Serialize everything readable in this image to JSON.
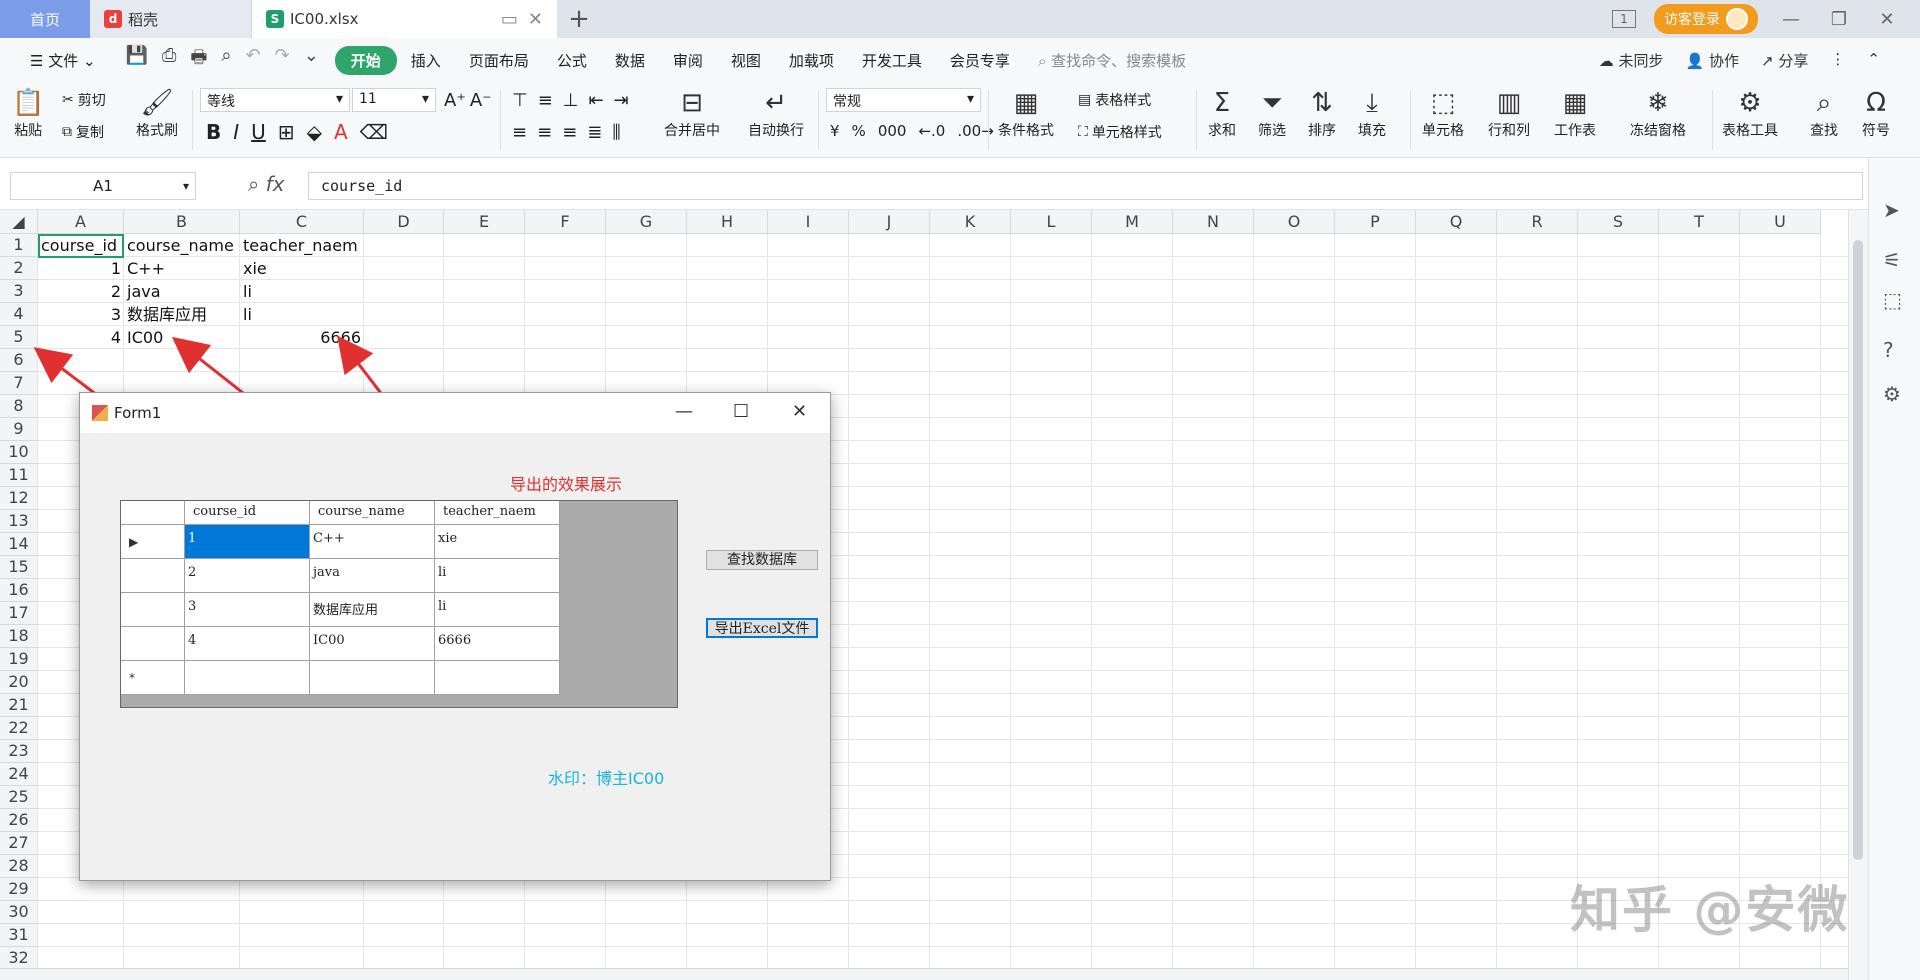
{
  "titlebar": {
    "tabs": [
      {
        "label": "首页"
      },
      {
        "label": "稻壳"
      },
      {
        "label": "IC00.xlsx"
      }
    ],
    "login": "访客登录",
    "page_badge": "1"
  },
  "menubar": {
    "file": "文件",
    "items": [
      "开始",
      "插入",
      "页面布局",
      "公式",
      "数据",
      "审阅",
      "视图",
      "加载项",
      "开发工具",
      "会员专享"
    ],
    "search": "查找命令、搜索模板",
    "sync": "未同步",
    "collab": "协作",
    "share": "分享"
  },
  "ribbon": {
    "paste": "粘贴",
    "cut": "剪切",
    "copy": "复制",
    "format_painter": "格式刷",
    "font": "等线",
    "font_size": "11",
    "merge": "合并居中",
    "wrap": "自动换行",
    "number_format": "常规",
    "cond_format": "条件格式",
    "table_style": "表格样式",
    "cell_style": "单元格样式",
    "sum": "求和",
    "filter": "筛选",
    "sort": "排序",
    "fill": "填充",
    "cell": "单元格",
    "row_col": "行和列",
    "sheet": "工作表",
    "freeze": "冻结窗格",
    "table_tools": "表格工具",
    "find": "查找",
    "symbol": "符号"
  },
  "formula_bar": {
    "cell_ref": "A1",
    "fx": "fx",
    "content": "course_id"
  },
  "columns": [
    "A",
    "B",
    "C",
    "D",
    "E",
    "F",
    "G",
    "H",
    "I",
    "J",
    "K",
    "L",
    "M",
    "N",
    "O",
    "P",
    "Q",
    "R",
    "S",
    "T",
    "U"
  ],
  "rows": [
    "1",
    "2",
    "3",
    "4",
    "5",
    "6",
    "7",
    "8",
    "9",
    "10",
    "11",
    "12",
    "13",
    "14",
    "15",
    "16",
    "17",
    "18",
    "19",
    "20",
    "21",
    "22",
    "23",
    "24",
    "25",
    "26",
    "27",
    "28",
    "29",
    "30",
    "31",
    "32"
  ],
  "sheet": {
    "header": [
      "course_id",
      "course_name",
      "teacher_naem"
    ],
    "data": [
      [
        "1",
        "C++",
        "xie"
      ],
      [
        "2",
        "java",
        "li"
      ],
      [
        "3",
        "数据库应用",
        "li"
      ],
      [
        "4",
        "IC00",
        "6666"
      ]
    ]
  },
  "form": {
    "title": "Form1",
    "annotation": "导出的效果展示",
    "grid_header": [
      "course_id",
      "course_name",
      "teacher_naem"
    ],
    "grid_rows": [
      [
        "1",
        "C++",
        "xie"
      ],
      [
        "2",
        "java",
        "li"
      ],
      [
        "3",
        "数据库应用",
        "li"
      ],
      [
        "4",
        "IC00",
        "6666"
      ]
    ],
    "btn_query": "查找数据库",
    "btn_export": "导出Excel文件",
    "watermark": "水印：博主IC00"
  },
  "site_watermark": "知乎 @安微",
  "colors": {
    "accent_green": "#2fa56b",
    "home_tab": "#7b9de8",
    "login": "#f29b1d",
    "arrow_red": "#e03030",
    "selection_blue": "#0078d7",
    "watermark_cyan": "#17b5d6"
  }
}
